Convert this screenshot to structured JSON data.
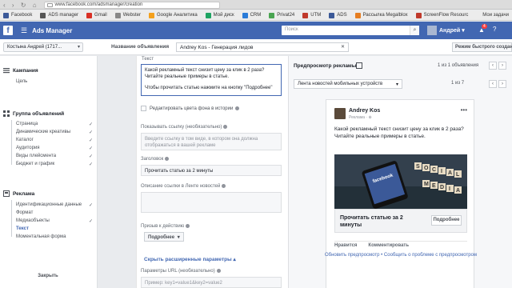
{
  "browser": {
    "url": "www.facebook.com/adsmanager/creation",
    "bookmarks": [
      {
        "label": "Facebook",
        "color": "#3b5998"
      },
      {
        "label": "ADS manager",
        "color": "#555555"
      },
      {
        "label": "Gmail",
        "color": "#d93025"
      },
      {
        "label": "Webster",
        "color": "#888888"
      },
      {
        "label": "Google Аналитика",
        "color": "#f4a01c"
      },
      {
        "label": "Мой диск",
        "color": "#1fa463"
      },
      {
        "label": "CRM",
        "color": "#2a7bd8"
      },
      {
        "label": "Privat24",
        "color": "#4aa552"
      },
      {
        "label": "UTM",
        "color": "#c0392b"
      },
      {
        "label": "ADS",
        "color": "#3b5998"
      },
      {
        "label": "Рассылка Megalblox",
        "color": "#e67e22"
      },
      {
        "label": "ScreenFlow Resourc",
        "color": "#c0392b"
      }
    ],
    "more_label": "Мои задачи"
  },
  "header": {
    "app_title": "Ads Manager",
    "search_placeholder": "Поиск",
    "user_name": "Андрей",
    "notif_count": "4"
  },
  "subheader": {
    "account": "Костына Андрей (1717...",
    "ad_name_label": "Название объявления",
    "ad_name_value": "Andrey Kos - Генерация лидов",
    "quick_edit": "Режим быстрого создан"
  },
  "sidebar": {
    "campaign_title": "Кампания",
    "campaign_items": [
      {
        "label": "Цель",
        "check": ""
      }
    ],
    "adset_title": "Группа объявлений",
    "adset_items": [
      {
        "label": "Страница",
        "check": "✓"
      },
      {
        "label": "Динамические креативы",
        "check": "✓"
      },
      {
        "label": "Каталог",
        "check": "✓"
      },
      {
        "label": "Аудитория",
        "check": "✓"
      },
      {
        "label": "Виды плейсмента",
        "check": "✓"
      },
      {
        "label": "Бюджет и график",
        "check": "✓"
      }
    ],
    "ad_title": "Реклама",
    "ad_items": [
      {
        "label": "Идентификационные данные",
        "check": "✓"
      },
      {
        "label": "Формат",
        "check": ""
      },
      {
        "label": "Медиаобъекты",
        "check": "✓"
      },
      {
        "label": "Текст",
        "check": ""
      },
      {
        "label": "Моментальная форма",
        "check": ""
      }
    ],
    "close_label": "Закрыть"
  },
  "form": {
    "text_label": "Текст",
    "text_line1": "Какой рекламный текст снизит цену за клик в 2 раза? Читайте реальные примеры в статье.",
    "text_line2": "Чтобы прочитать статью нажмите на кнопку \"Подробнее\"",
    "edit_bg_label": "Редактировать цвета фона в истории",
    "show_link_label": "Показывать ссылку (необязательно)",
    "show_link_placeholder": "Введите ссылку в том виде, в котором она должна отображаться в вашей рекламе",
    "headline_label": "Заголовок",
    "headline_value": "Прочитать статью за 2 минуты",
    "news_desc_label": "Описание ссылки в Ленте новостей",
    "cta_label": "Призыв к действию",
    "cta_value": "Подробнее",
    "advanced_link": "Скрыть расширенные параметры",
    "url_params_label": "Параметры URL (необязательно)",
    "url_params_placeholder": "Пример: key1=value1&key2=value2"
  },
  "preview": {
    "title": "Предпросмотр рекламы",
    "count_ads": "1 из 1 объявления",
    "placement": "Лента новостей мобильных устройств",
    "count_placements": "1 из 7",
    "page_name": "Andrey Kos",
    "sponsored": "Реклама · ⊕",
    "ad_text": "Какой рекламный текст снизит цену за клик в 2 раза? Читайте реальные примеры в статье.",
    "link_title": "Прочитать статью за 2 минуты",
    "cta": "Подробнее",
    "like": "Нравится",
    "comment": "Комментировать",
    "footer": "Обновить предпросмотр • Сообщить о проблеме с предпросмотром"
  },
  "colors": {
    "fb_blue": "#4267b2",
    "link_blue": "#4267b2"
  }
}
